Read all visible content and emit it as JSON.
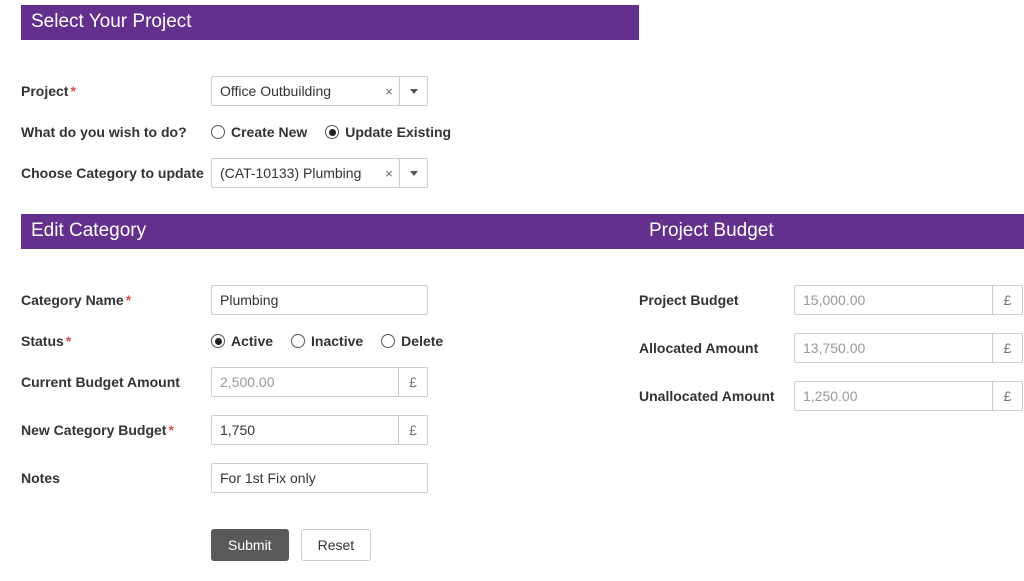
{
  "currency": "£",
  "sections": {
    "select_project": "Select Your Project",
    "edit_category": "Edit Category",
    "project_budget": "Project Budget"
  },
  "select": {
    "project_label": "Project",
    "project_value": "Office Outbuilding",
    "action_label": "What do you wish to do?",
    "action_options": {
      "create_new": "Create New",
      "update_existing": "Update Existing"
    },
    "action_selected": "update_existing",
    "category_label": "Choose Category to update",
    "category_value": "(CAT-10133) Plumbing"
  },
  "edit": {
    "category_name_label": "Category Name",
    "category_name_value": "Plumbing",
    "status_label": "Status",
    "status_options": {
      "active": "Active",
      "inactive": "Inactive",
      "delete": "Delete"
    },
    "status_selected": "active",
    "current_budget_label": "Current Budget Amount",
    "current_budget_value": "2,500.00",
    "new_budget_label": "New Category Budget",
    "new_budget_value": "1,750",
    "notes_label": "Notes",
    "notes_value": "For 1st Fix only"
  },
  "budget": {
    "project_budget_label": "Project Budget",
    "project_budget_value": "15,000.00",
    "allocated_label": "Allocated Amount",
    "allocated_value": "13,750.00",
    "unallocated_label": "Unallocated Amount",
    "unallocated_value": "1,250.00"
  },
  "buttons": {
    "submit": "Submit",
    "reset": "Reset"
  }
}
